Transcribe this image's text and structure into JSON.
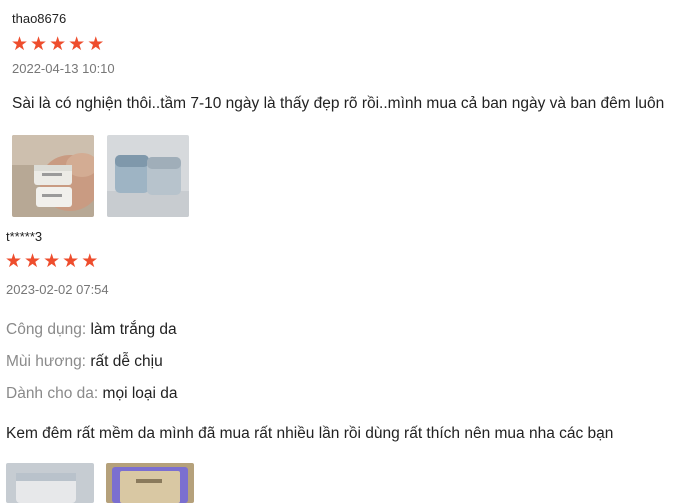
{
  "reviews": [
    {
      "username": "thao8676",
      "rating": 5,
      "date": "2022-04-13 10:10",
      "text": "Sài là có nghiện thôi..tầm 7-10 ngày là thấy đẹp rõ rồi..mình mua cả ban ngày và ban đêm luôn",
      "images": [
        "product-photo-hand-jar",
        "product-photo-two-jars"
      ]
    },
    {
      "username": "t*****3",
      "rating": 5,
      "date": "2023-02-02 07:54",
      "attributes": [
        {
          "key": "Công dụng:",
          "value": "làm trắng da"
        },
        {
          "key": "Mùi hương:",
          "value": "rất dễ chịu"
        },
        {
          "key": "Dành cho da:",
          "value": "mọi loại da"
        }
      ],
      "text": "Kem đêm rất mềm da mình đã mua rất nhiều lần rồi dùng rất thích nên mua nha các bạn",
      "images": [
        "product-photo-jar",
        "product-photo-jar-box"
      ]
    }
  ],
  "colors": {
    "star": "#ee4d2d",
    "label": "#8a8a8a",
    "date": "#777777"
  }
}
